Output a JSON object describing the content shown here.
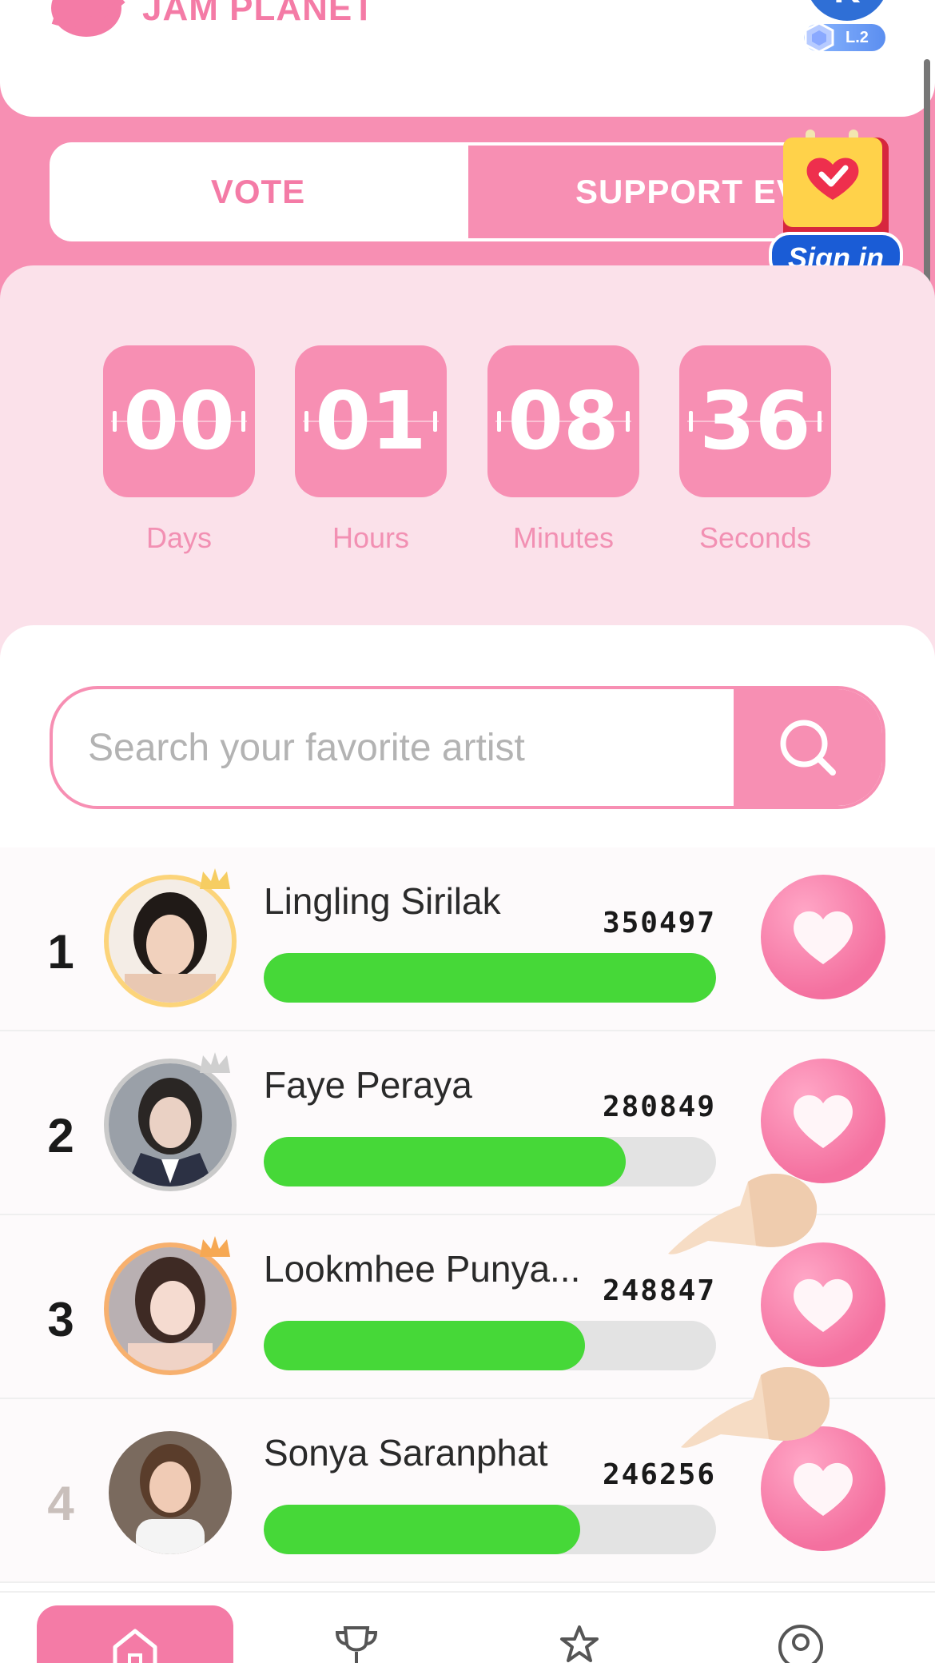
{
  "header": {
    "app_title": "JAM PLANET",
    "user_initial": "K",
    "level": "L.2"
  },
  "tabs": [
    {
      "label": "VOTE",
      "active": true
    },
    {
      "label": "SUPPORT EVE",
      "active": false
    }
  ],
  "signin": {
    "label": "Sign in"
  },
  "countdown": [
    {
      "value": "00",
      "label": "Days"
    },
    {
      "value": "01",
      "label": "Hours"
    },
    {
      "value": "08",
      "label": "Minutes"
    },
    {
      "value": "36",
      "label": "Seconds"
    }
  ],
  "search": {
    "placeholder": "Search your favorite artist",
    "value": ""
  },
  "artists": [
    {
      "rank": "1",
      "name": "Lingling Sirilak",
      "votes": "350497",
      "progress": 1.0,
      "crown": "gold"
    },
    {
      "rank": "2",
      "name": "Faye Peraya",
      "votes": "280849",
      "progress": 0.8,
      "crown": "silver"
    },
    {
      "rank": "3",
      "name": "Lookmhee Punya...",
      "votes": "248847",
      "progress": 0.71,
      "crown": "bronze"
    },
    {
      "rank": "4",
      "name": "Sonya Saranphat",
      "votes": "246256",
      "progress": 0.7,
      "crown": "none"
    }
  ],
  "colors": {
    "primary_pink": "#f78fb3",
    "accent_pink": "#f47ba6",
    "progress_green": "#46d838",
    "panel_pink": "#fbe1ea"
  },
  "nav": [
    {
      "icon": "home-icon",
      "active": true
    },
    {
      "icon": "trophy-icon",
      "active": false
    },
    {
      "icon": "star-icon",
      "active": false
    },
    {
      "icon": "profile-icon",
      "active": false
    }
  ]
}
